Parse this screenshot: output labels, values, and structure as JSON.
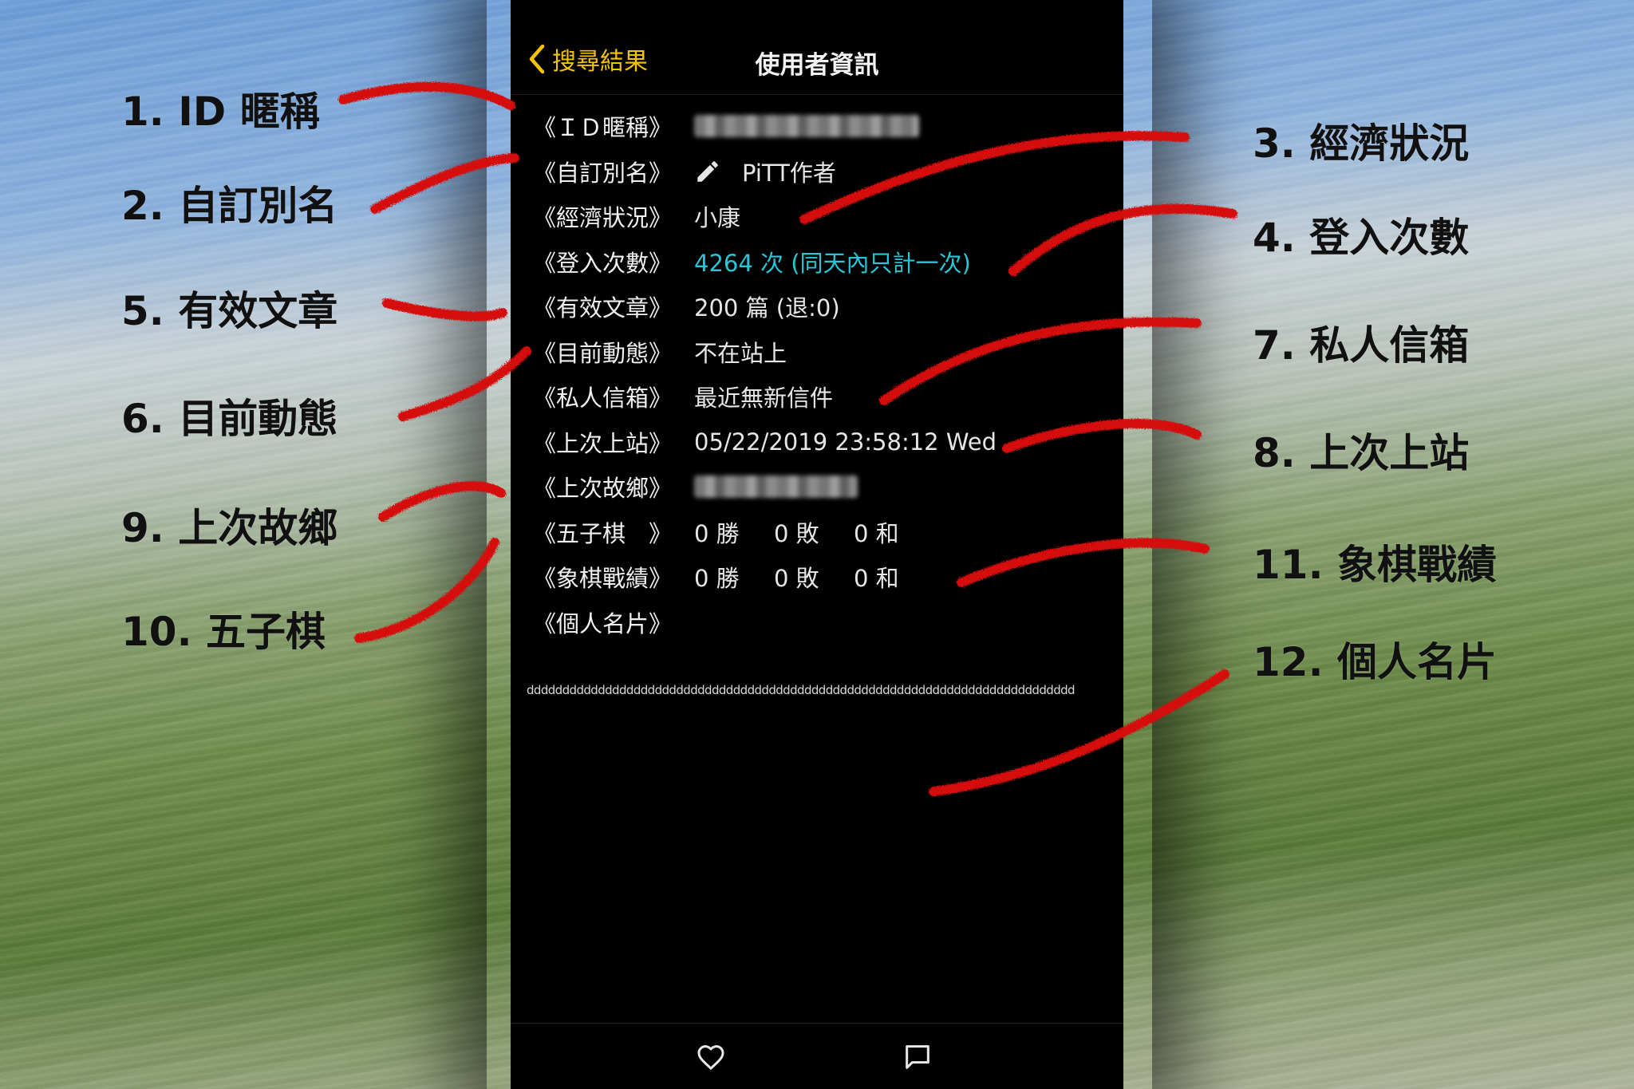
{
  "header": {
    "back_label": "搜尋結果",
    "title": "使用者資訊"
  },
  "rows": [
    {
      "label": "《ＩＤ暱稱》",
      "value": ""
    },
    {
      "label": "《自訂別名》",
      "value": "PiTT作者"
    },
    {
      "label": "《經濟狀況》",
      "value": "小康"
    },
    {
      "label": "《登入次數》",
      "value": "4264 次 (同天內只計一次)"
    },
    {
      "label": "《有效文章》",
      "value": "200 篇 (退:0)"
    },
    {
      "label": "《目前動態》",
      "value": "不在站上"
    },
    {
      "label": "《私人信箱》",
      "value": "最近無新信件"
    },
    {
      "label": "《上次上站》",
      "value": "05/22/2019 23:58:12 Wed"
    },
    {
      "label": "《上次故鄉》",
      "value": ""
    },
    {
      "label": "《五子棋　》",
      "win": "0 勝",
      "lose": "0 敗",
      "draw": "0 和"
    },
    {
      "label": "《象棋戰績》",
      "win": "0 勝",
      "lose": "0 敗",
      "draw": "0 和"
    },
    {
      "label": "《個人名片》",
      "value": ""
    }
  ],
  "card_text": "ddddddddddddddddddddddddddddddddddddddddddddddddddddddddddddddddddddddddddddd",
  "annotations_left": [
    "1. ID 暱稱",
    "2. 自訂別名",
    "5. 有效文章",
    "6. 目前動態",
    "9. 上次故鄉",
    "10. 五子棋"
  ],
  "annotations_right": [
    "3. 經濟狀況",
    "4. 登入次數",
    "7. 私人信箱",
    "8. 上次上站",
    "11. 象棋戰績",
    "12. 個人名片"
  ],
  "colors": {
    "accent": "#f4c400",
    "cyan_value": "#29c6d6",
    "annotation_stroke": "#d60a0a",
    "phone_bg": "#000000"
  },
  "icons": {
    "back": "chevron-left-icon",
    "alias": "pencil-icon",
    "tab_like": "heart-icon",
    "tab_message": "chat-bubble-icon"
  }
}
